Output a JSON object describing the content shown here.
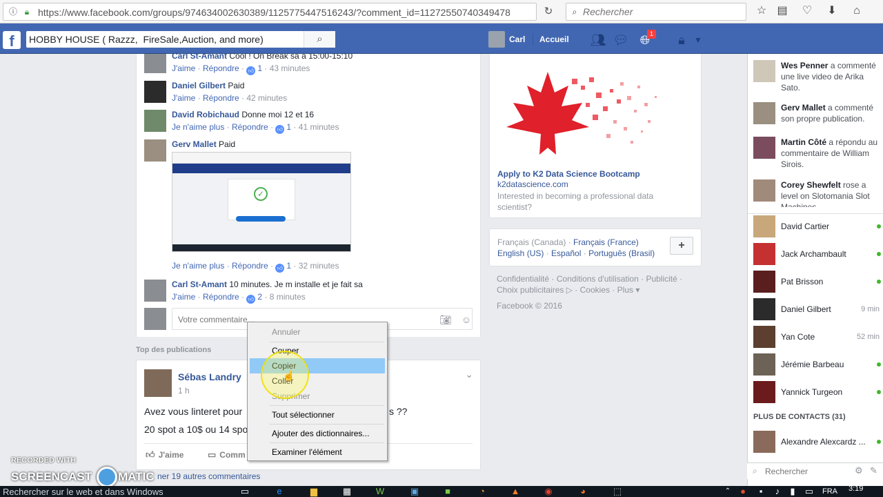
{
  "browser": {
    "url": "https://www.facebook.com/groups/974634002630389/1125775447516243/?comment_id=1127255074034947­8",
    "search_placeholder": "Rechercher"
  },
  "header": {
    "logo": "f",
    "group_search_value": "HOBBY HOUSE ( Razzz,  FireSale,Auction, and more)",
    "user_name": "Carl",
    "home_label": "Accueil",
    "notif_count": "1"
  },
  "comments": [
    {
      "author": "Carl St-Amant",
      "text": " Cool ! On Break sa a 15:00-15:10",
      "action1": "J'aime",
      "action2": "Répondre",
      "likes": "1",
      "time": "43 minutes"
    },
    {
      "author": "Daniel Gilbert",
      "text": " Paid",
      "action1": "J'aime",
      "action2": "Répondre",
      "likes": "",
      "time": "42 minutes"
    },
    {
      "author": "David Robichaud",
      "text": " Donne moi 12 et 16",
      "action1": "Je n'aime plus",
      "action2": "Répondre",
      "likes": "1",
      "time": "41 minutes"
    },
    {
      "author": "Gerv Mallet",
      "text": " Paid",
      "action1": "Je n'aime plus",
      "action2": "Répondre",
      "likes": "1",
      "time": "32 minutes"
    },
    {
      "author": "Carl St-Amant",
      "text": " 10 minutes. Je m installe et je fait sa",
      "action1": "J'aime",
      "action2": "Répondre",
      "likes": "2",
      "time": "8 minutes"
    }
  ],
  "reply_placeholder": "Votre commentaire...",
  "top_publications": "Top des publications",
  "post": {
    "author": "Sébas Landry",
    "time": "1 h",
    "line1_a": "Avez vous linteret pour",
    "line1_b": "s ??",
    "line2": "20 spot a 10$ ou 14 spo",
    "like_label": "J'aime",
    "comment_label": "Comm",
    "more_comments": "ner 19 autres commentaires"
  },
  "ad": {
    "title": "Apply to K2 Data Science Bootcamp",
    "domain": "k2datascience.com",
    "description": "Interested in becoming a professional data scientist?"
  },
  "languages": {
    "current": "Français (Canada)",
    "links": [
      "Français (France)",
      "English (US)",
      "Español",
      "Português (Brasil)"
    ],
    "add": "+"
  },
  "footer": {
    "links": [
      "Confidentialité",
      "Conditions d'utilisation",
      "Publicité",
      "Choix publicitaires",
      "Cookies",
      "Plus"
    ],
    "copyright": "Facebook © 2016"
  },
  "ticker": [
    {
      "name": "Wes Penner",
      "text": " a commenté une live video de Arika Sato."
    },
    {
      "name": "Gerv Mallet",
      "text": " a commenté son propre publication."
    },
    {
      "name": "Martin Côté",
      "text": " a répondu au commentaire de William Sirois."
    },
    {
      "name": "Corey Shewfelt",
      "text": " rose a level on Slotomania Slot Machines."
    }
  ],
  "contacts": [
    {
      "name": "David Cartier",
      "status": ""
    },
    {
      "name": "Jack Archambault",
      "status": ""
    },
    {
      "name": "Pat Brisson",
      "status": ""
    },
    {
      "name": "Daniel Gilbert",
      "status": "9 min"
    },
    {
      "name": "Yan Cote",
      "status": "52 min"
    },
    {
      "name": "Jérémie Barbeau",
      "status": ""
    },
    {
      "name": "Yannick Turgeon",
      "status": ""
    }
  ],
  "more_contacts": "PLUS DE CONTACTS (31)",
  "extra_contact": "Alexandre Alexcardz ...",
  "chat_search_placeholder": "Rechercher",
  "context_menu": {
    "undo": "Annuler",
    "cut": "Couper",
    "copy": "Copier",
    "paste": "Coller",
    "delete": "Supprimer",
    "select_all": "Tout sélectionner",
    "add_dict": "Ajouter des dictionnaires...",
    "inspect": "Examiner l'élément"
  },
  "watermark": {
    "line1": "RECORDED WITH",
    "line2_a": "SCREENCAST",
    "line2_b": "MATIC"
  },
  "taskbar": {
    "search": "Rechercher sur le web et dans Windows",
    "lang": "FRA",
    "time": "3:19"
  },
  "colors": {
    "fb_blue": "#4267b2",
    "link": "#365899",
    "highlight": "#91c9f7"
  }
}
